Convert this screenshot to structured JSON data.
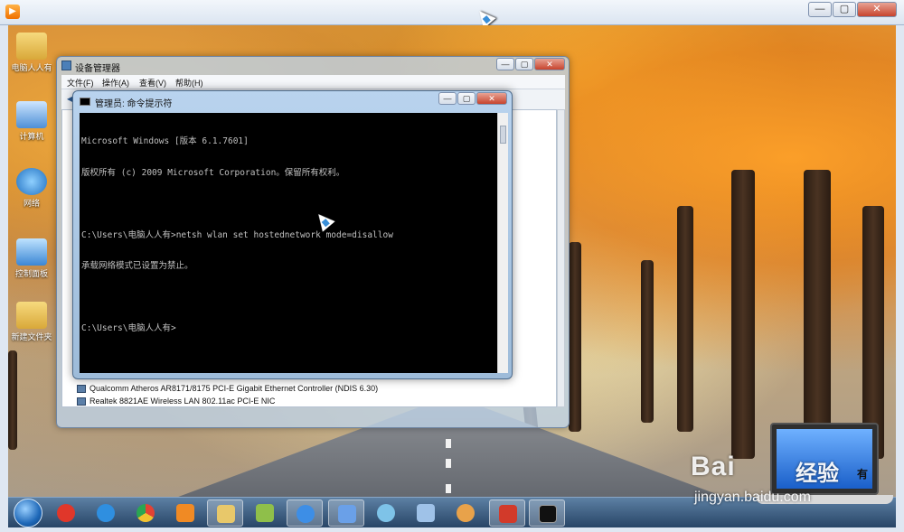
{
  "player": {
    "controls": {
      "minimize": "—",
      "restore": "▢",
      "close": "✕"
    }
  },
  "desktop_icons": [
    {
      "label": "电脑人人有",
      "icon": "folder-icon"
    },
    {
      "label": "计算机",
      "icon": "computer-icon"
    },
    {
      "label": "网络",
      "icon": "network-icon"
    },
    {
      "label": "控制面板",
      "icon": "control-panel-icon"
    },
    {
      "label": "新建文件夹",
      "icon": "folder-icon"
    }
  ],
  "device_manager": {
    "title": "设备管理器",
    "menu": [
      "文件(F)",
      "操作(A)",
      "查看(V)",
      "帮助(H)"
    ],
    "devices": [
      "Qualcomm Atheros AR8171/8175 PCI-E Gigabit Ethernet Controller (NDIS 6.30)",
      "Realtek 8821AE Wireless LAN 802.11ac PCI-E NIC"
    ]
  },
  "cmd_window": {
    "title": "管理员: 命令提示符",
    "lines": [
      "Microsoft Windows [版本 6.1.7601]",
      "版权所有 (c) 2009 Microsoft Corporation。保留所有权利。",
      "",
      "C:\\Users\\电脑人人有>netsh wlan set hostednetwork mode=disallow",
      "承载网络模式已设置为禁止。",
      "",
      "C:\\Users\\电脑人人有>"
    ]
  },
  "taskbar": {
    "items": [
      {
        "name": "jiangmin-icon",
        "color": "#e0372a"
      },
      {
        "name": "internet-explorer-icon",
        "color": "#2f8fe0"
      },
      {
        "name": "chrome-icon",
        "color": "#e7b52c"
      },
      {
        "name": "media-player-icon",
        "color": "#f08a24"
      },
      {
        "name": "file-explorer-icon",
        "color": "#e8c86a"
      },
      {
        "name": "folder-share-icon",
        "color": "#8fbf4a"
      },
      {
        "name": "browser-icon",
        "color": "#3d8ee6"
      },
      {
        "name": "document-icon",
        "color": "#6aa0e8"
      },
      {
        "name": "network-settings-icon",
        "color": "#7ec3e8"
      },
      {
        "name": "remote-desktop-icon",
        "color": "#9fc2e8"
      },
      {
        "name": "paint-icon",
        "color": "#e8a24a"
      },
      {
        "name": "toolbox-icon",
        "color": "#d23a2a"
      },
      {
        "name": "command-prompt-icon",
        "color": "#111111"
      }
    ]
  },
  "watermark": {
    "logo": "Bai",
    "logo_suffix": "经验",
    "laptop_text": "有",
    "url": "jingyan.baidu.com"
  }
}
